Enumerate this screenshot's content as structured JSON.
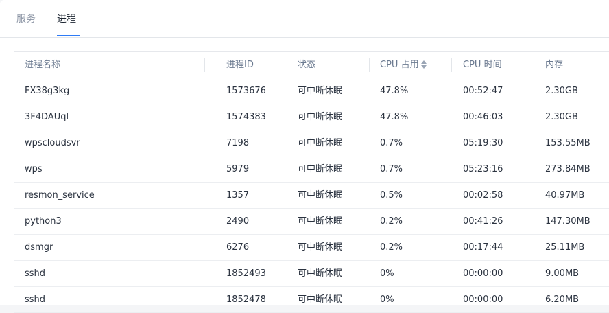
{
  "tabs": [
    {
      "label": "服务",
      "active": false
    },
    {
      "label": "进程",
      "active": true
    }
  ],
  "accent_color": "#2f7bf5",
  "table": {
    "headers": [
      "进程名称",
      "进程ID",
      "状态",
      "CPU 占用",
      "CPU 时间",
      "内存"
    ],
    "sort_icon": "sort-updown-icon",
    "rows": [
      [
        "FX38g3kg",
        "1573676",
        "可中断休眠",
        "47.8%",
        "00:52:47",
        "2.30GB"
      ],
      [
        "3F4DAUql",
        "1574383",
        "可中断休眠",
        "47.8%",
        "00:46:03",
        "2.30GB"
      ],
      [
        "wpscloudsvr",
        "7198",
        "可中断休眠",
        "0.7%",
        "05:19:30",
        "153.55MB"
      ],
      [
        "wps",
        "5979",
        "可中断休眠",
        "0.7%",
        "05:23:16",
        "273.84MB"
      ],
      [
        "resmon_service",
        "1357",
        "可中断休眠",
        "0.5%",
        "00:02:58",
        "40.97MB"
      ],
      [
        "python3",
        "2490",
        "可中断休眠",
        "0.2%",
        "00:41:26",
        "147.30MB"
      ],
      [
        "dsmgr",
        "6276",
        "可中断休眠",
        "0.2%",
        "00:17:44",
        "25.11MB"
      ],
      [
        "sshd",
        "1852493",
        "可中断休眠",
        "0%",
        "00:00:00",
        "9.00MB"
      ],
      [
        "sshd",
        "1852478",
        "可中断休眠",
        "0%",
        "00:00:00",
        "6.20MB"
      ]
    ]
  }
}
